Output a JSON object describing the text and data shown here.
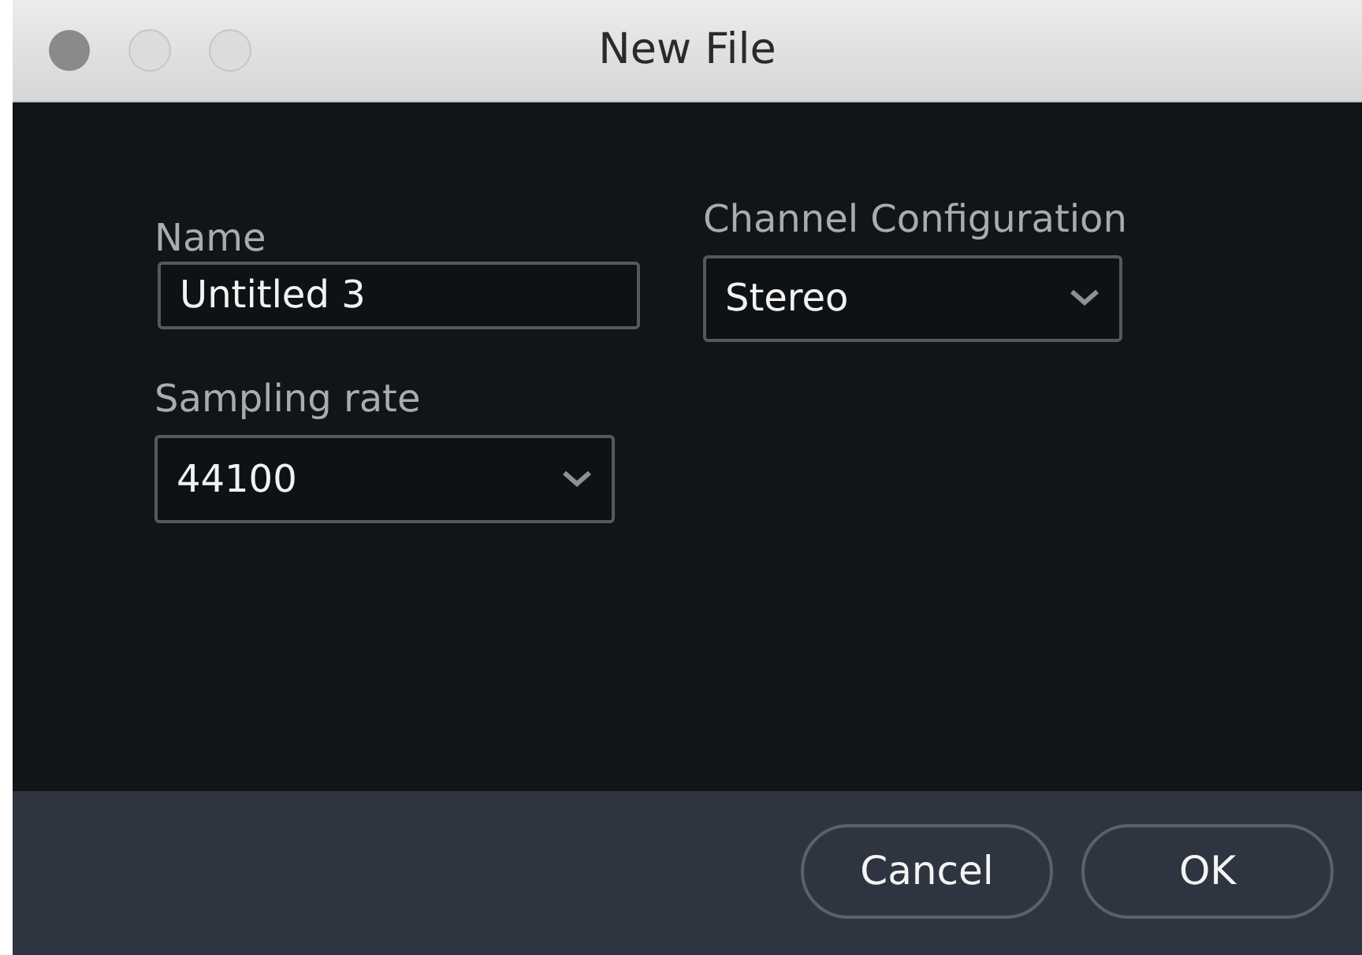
{
  "window": {
    "title": "New File"
  },
  "fields": [
    {
      "kind": "text",
      "label": "Name",
      "value": "Untitled 3"
    },
    {
      "kind": "select",
      "label": "Sampling rate",
      "value": "44100"
    },
    {
      "kind": "select",
      "label": "Channel Configuration",
      "value": "Stereo"
    }
  ],
  "buttons": [
    "Cancel",
    "OK"
  ]
}
